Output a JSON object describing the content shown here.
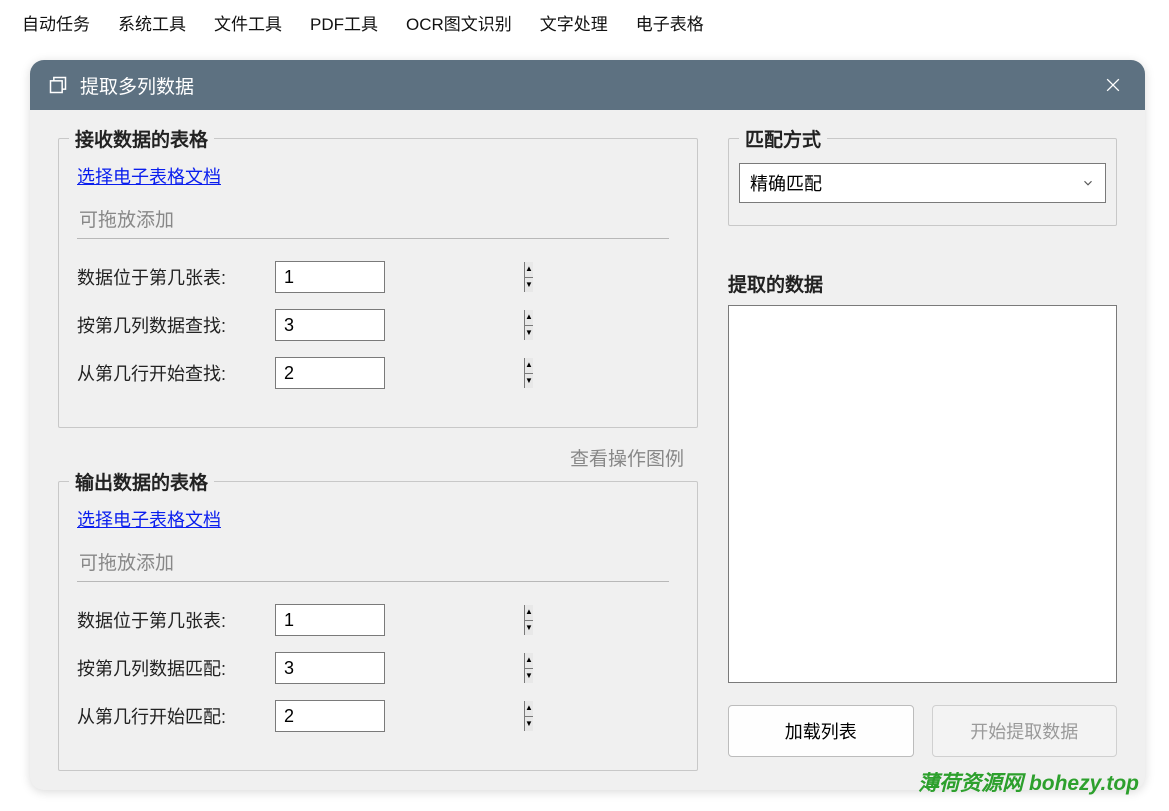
{
  "menubar": {
    "items": [
      "自动任务",
      "系统工具",
      "文件工具",
      "PDF工具",
      "OCR图文识别",
      "文字处理",
      "电子表格"
    ]
  },
  "dialog": {
    "title": "提取多列数据",
    "receive": {
      "legend": "接收数据的表格",
      "link": "选择电子表格文档",
      "placeholder": "可拖放添加",
      "rows": [
        {
          "label": "数据位于第几张表:",
          "value": "1"
        },
        {
          "label": "按第几列数据查找:",
          "value": "3"
        },
        {
          "label": "从第几行开始查找:",
          "value": "2"
        }
      ]
    },
    "view_diagram": "查看操作图例",
    "output": {
      "legend": "输出数据的表格",
      "link": "选择电子表格文档",
      "placeholder": "可拖放添加",
      "rows": [
        {
          "label": "数据位于第几张表:",
          "value": "1"
        },
        {
          "label": "按第几列数据匹配:",
          "value": "3"
        },
        {
          "label": "从第几行开始匹配:",
          "value": "2"
        }
      ]
    },
    "match": {
      "legend": "匹配方式",
      "selected": "精确匹配"
    },
    "extracted": {
      "legend": "提取的数据"
    },
    "buttons": {
      "load": "加载列表",
      "start": "开始提取数据"
    }
  },
  "watermark": "薄荷资源网  bohezy.top"
}
